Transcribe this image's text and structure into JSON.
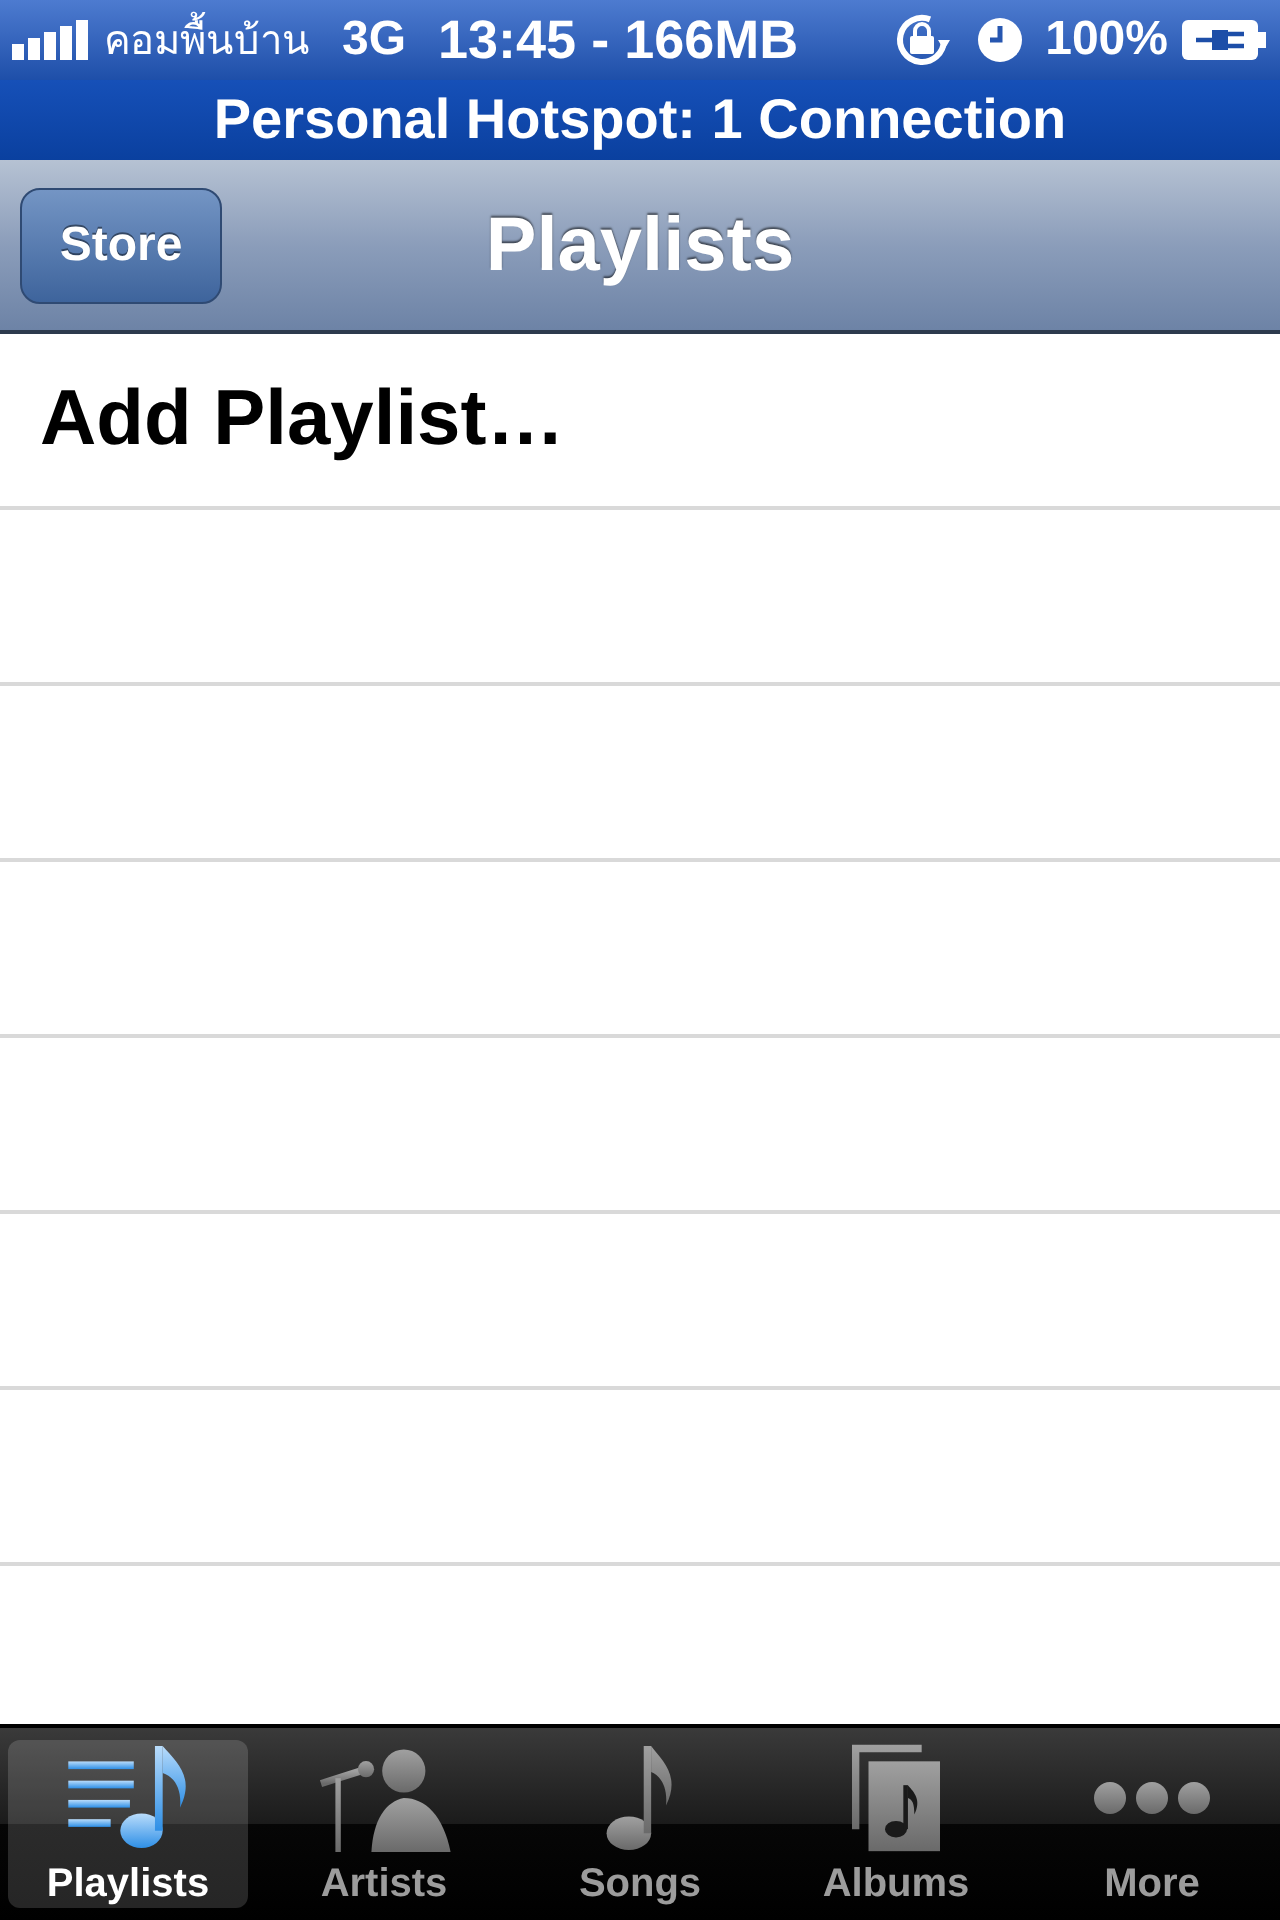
{
  "status_bar": {
    "carrier": "คอมพื้นบ้าน",
    "network": "3G",
    "time": "13:45 - 166MB",
    "battery": "100%"
  },
  "hotspot_banner": {
    "text": "Personal Hotspot: 1 Connection"
  },
  "nav_bar": {
    "left_button": "Store",
    "title": "Playlists"
  },
  "list": {
    "rows": [
      {
        "label": "Add Playlist…"
      }
    ]
  },
  "tab_bar": {
    "items": [
      {
        "kind": "playlists",
        "label": "Playlists",
        "selected": true
      },
      {
        "kind": "artists",
        "label": "Artists",
        "selected": false
      },
      {
        "kind": "songs",
        "label": "Songs",
        "selected": false
      },
      {
        "kind": "albums",
        "label": "Albums",
        "selected": false
      },
      {
        "kind": "more",
        "label": "More",
        "selected": false
      }
    ]
  }
}
